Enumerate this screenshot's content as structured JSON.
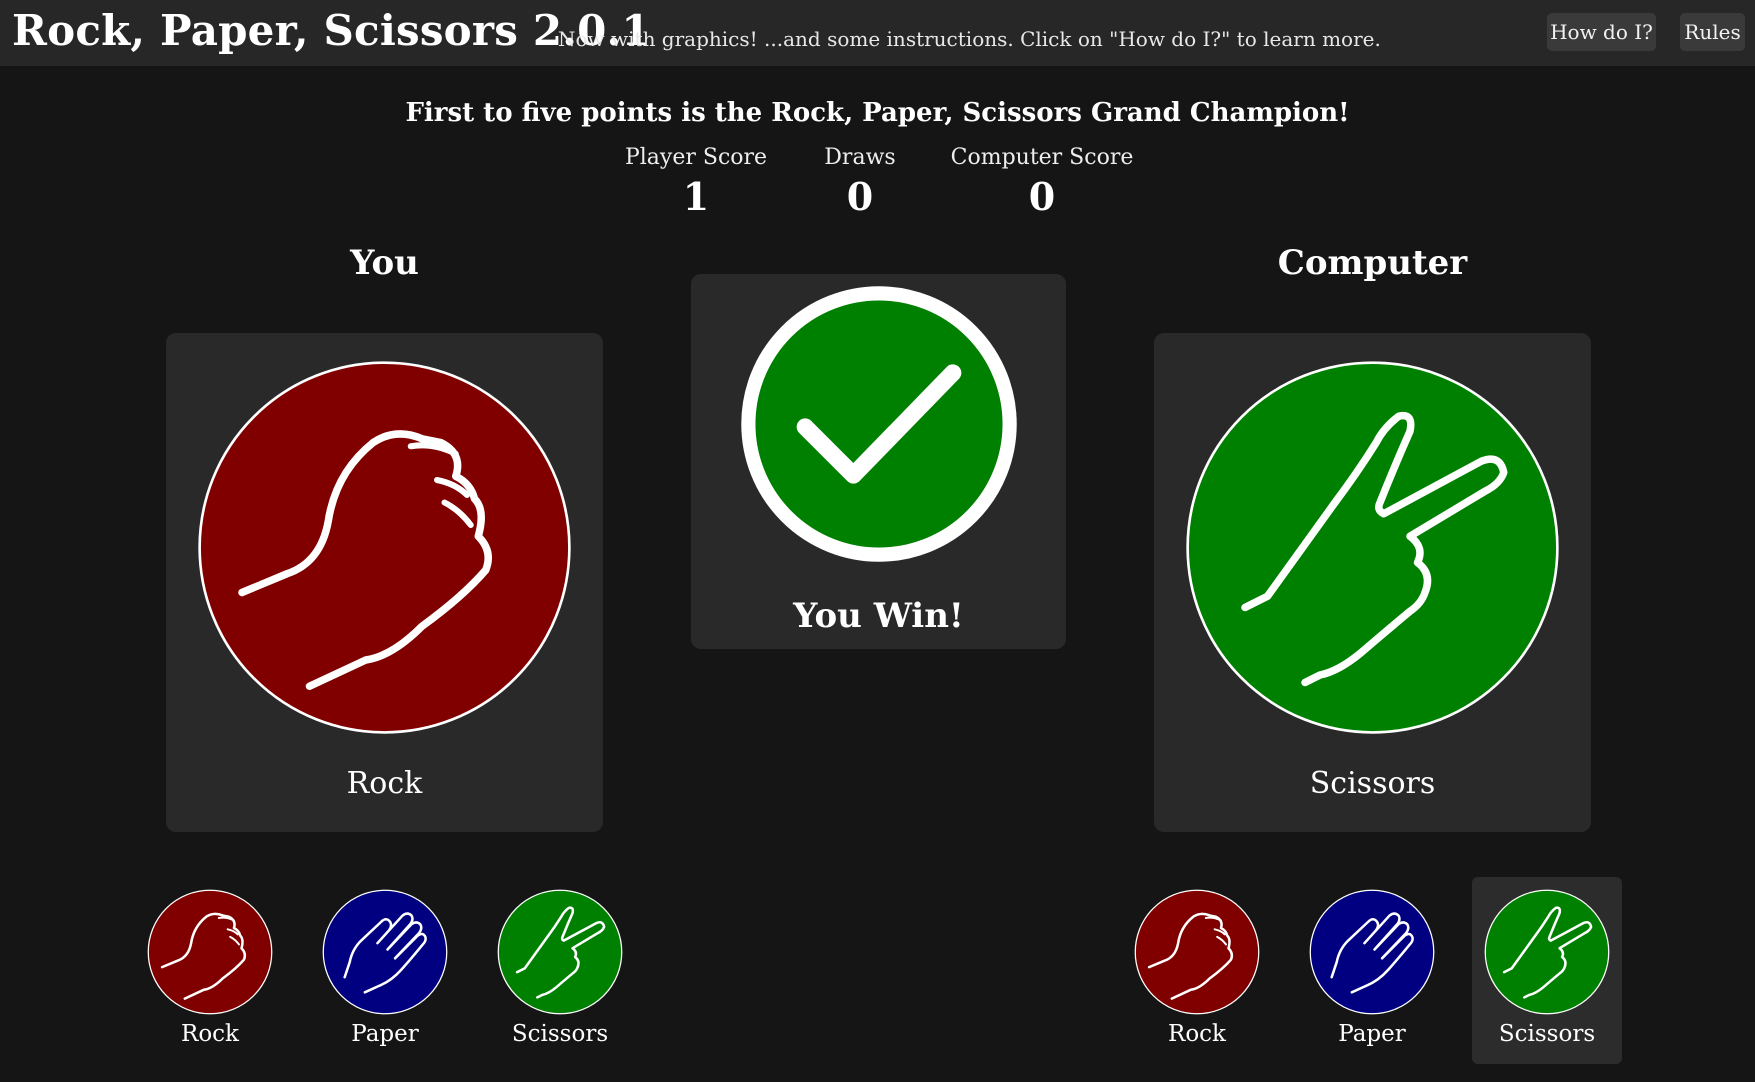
{
  "header": {
    "title": "Rock, Paper, Scissors 2.0.1",
    "subtitle": "Now with graphics! ...and some instructions. Click on \"How do I?\" to learn more.",
    "buttons": {
      "how": "How do I?",
      "rules": "Rules"
    }
  },
  "headline": "First to five points is the Rock, Paper, Scissors Grand Champion!",
  "scores": {
    "player": {
      "label": "Player Score",
      "value": "1"
    },
    "draws": {
      "label": "Draws",
      "value": "0"
    },
    "computer": {
      "label": "Computer Score",
      "value": "0"
    }
  },
  "player": {
    "heading": "You",
    "choice": "Rock",
    "choice_color": "#800000",
    "choice_icon": "rock-hand-icon"
  },
  "computer": {
    "heading": "Computer",
    "choice": "Scissors",
    "choice_color": "#008000",
    "choice_icon": "scissors-hand-icon"
  },
  "result": {
    "text": "You Win!",
    "icon": "checkmark-icon",
    "color": "#008000"
  },
  "player_choices": [
    {
      "label": "Rock",
      "color": "#800000",
      "icon": "rock-hand-icon"
    },
    {
      "label": "Paper",
      "color": "#000080",
      "icon": "paper-hand-icon"
    },
    {
      "label": "Scissors",
      "color": "#008000",
      "icon": "scissors-hand-icon"
    }
  ],
  "computer_choices": [
    {
      "label": "Rock",
      "color": "#800000",
      "icon": "rock-hand-icon"
    },
    {
      "label": "Paper",
      "color": "#000080",
      "icon": "paper-hand-icon"
    },
    {
      "label": "Scissors",
      "color": "#008000",
      "icon": "scissors-hand-icon",
      "selected": true
    }
  ]
}
